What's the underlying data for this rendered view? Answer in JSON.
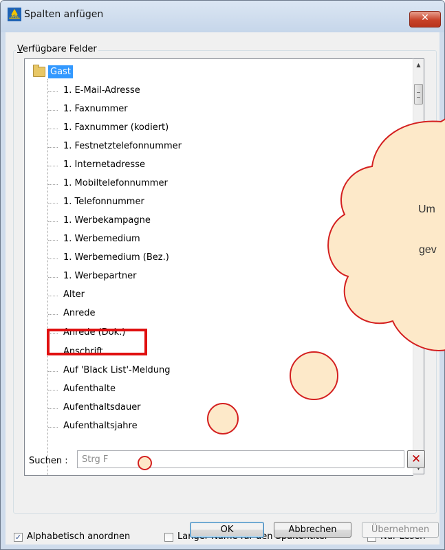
{
  "window": {
    "title": "Spalten anfügen",
    "close_glyph": "✕"
  },
  "group_title": "Verfügbare Felder",
  "tree": {
    "root": "Gast",
    "items": [
      "1. E-Mail-Adresse",
      "1. Faxnummer",
      "1. Faxnummer (kodiert)",
      "1. Festnetztelefonnummer",
      "1. Internetadresse",
      "1. Mobiltelefonnummer",
      "1. Telefonnummer",
      "1. Werbekampagne",
      "1. Werbemedium",
      "1. Werbemedium (Bez.)",
      "1. Werbepartner",
      "Alter",
      "Anrede",
      "Anrede (Dok.)",
      "Anschrift",
      "Auf 'Black List'-Meldung",
      "Aufenthalte",
      "Aufenthaltsdauer",
      "Aufenthaltsjahre"
    ],
    "highlighted_item": "Anrede (Dok.)"
  },
  "search": {
    "label": "Suchen :",
    "placeholder": "Strg F",
    "clear_glyph": "✕"
  },
  "options": [
    {
      "label": "Alphabetisch anordnen",
      "checked": true
    },
    {
      "label": "Langer Name für den Spaltentitel",
      "checked": false
    },
    {
      "label": "Nur Lesen",
      "checked": false
    }
  ],
  "buttons": {
    "ok": "OK",
    "cancel": "Abbrechen",
    "apply": "Übernehmen"
  },
  "callout": {
    "line1": "Um",
    "line2": "gev"
  },
  "colors": {
    "selection": "#3399ff",
    "annotation_red": "#e01010",
    "callout_fill": "#fde9c9"
  },
  "icons": [
    "app-logo-icon",
    "close-icon",
    "folder-icon",
    "scroll-up-icon",
    "scroll-down-icon",
    "clear-search-icon",
    "checkbox-checked-icon"
  ]
}
